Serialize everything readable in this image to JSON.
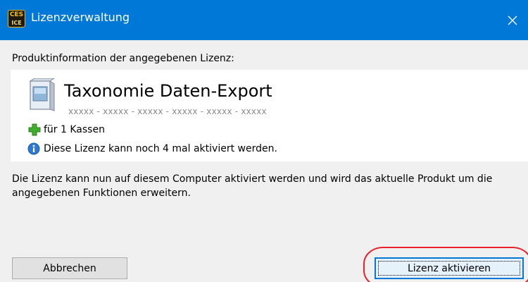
{
  "window": {
    "title": "Lizenzverwaltung",
    "app_icon_text_top": "CES",
    "app_icon_text_bottom": "ICE",
    "close_glyph": "×"
  },
  "intro_text": "Produktinformation der angegebenen Lizenz:",
  "product": {
    "name": "Taxonomie Daten-Export",
    "license_key": "xxxxx - xxxxx - xxxxx - xxxxx - xxxxx - xxxxx",
    "feature_text": "für 1 Kassen",
    "activation_info": "Diese Lizenz kann noch 4 mal aktiviert werden."
  },
  "description": "Die Lizenz kann nun auf diesem Computer aktiviert werden und wird das aktuelle Produkt um die angegebenen Funktionen erweitern.",
  "buttons": {
    "cancel_label": "Abbrechen",
    "activate_label": "Lizenz aktivieren"
  },
  "colors": {
    "titlebar": "#0078d7",
    "highlight": "#e8202a",
    "plus": "#3fae2a",
    "info": "#2f78d0"
  },
  "icons": {
    "app": "app-logo-icon",
    "close": "close-icon",
    "product": "software-box-icon",
    "feature": "plus-icon",
    "info": "info-icon"
  }
}
